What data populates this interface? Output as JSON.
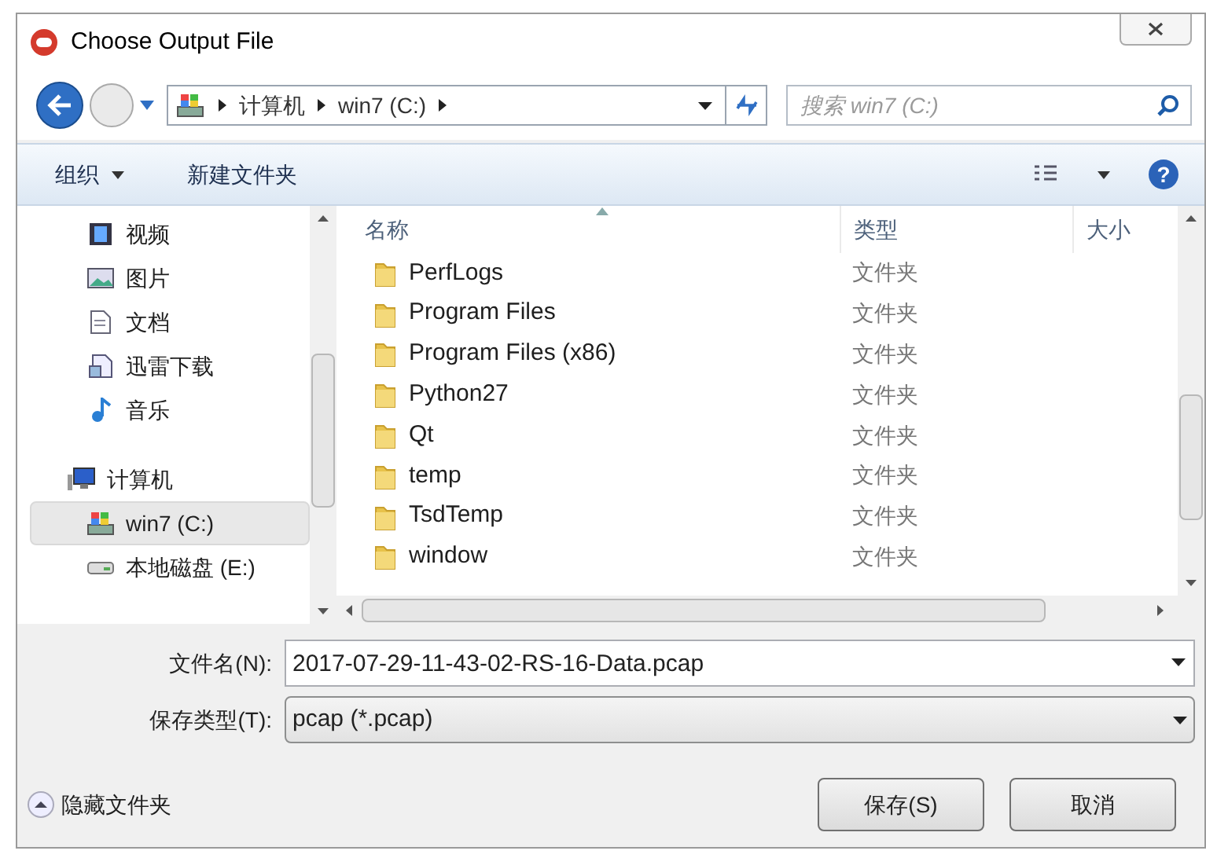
{
  "window": {
    "title": "Choose Output File"
  },
  "address": {
    "crumbs": [
      "计算机",
      "win7 (C:)"
    ]
  },
  "search": {
    "placeholder": "搜索 win7 (C:)"
  },
  "toolbar": {
    "organize": "组织",
    "new_folder": "新建文件夹",
    "help": "?"
  },
  "sidebar": {
    "items": [
      {
        "label": "视频",
        "kind": "video",
        "selected": false
      },
      {
        "label": "图片",
        "kind": "picture",
        "selected": false
      },
      {
        "label": "文档",
        "kind": "document",
        "selected": false
      },
      {
        "label": "迅雷下载",
        "kind": "download",
        "selected": false
      },
      {
        "label": "音乐",
        "kind": "music",
        "selected": false
      },
      {
        "label": "计算机",
        "kind": "computer",
        "selected": false,
        "children": [
          {
            "label": "win7 (C:)",
            "kind": "system-drive",
            "selected": true
          },
          {
            "label": "本地磁盘 (E:)",
            "kind": "drive",
            "selected": false
          }
        ]
      }
    ]
  },
  "table": {
    "columns": [
      "名称",
      "类型",
      "大小"
    ],
    "rows": [
      {
        "name": "PerfLogs",
        "type": "文件夹"
      },
      {
        "name": "Program Files",
        "type": "文件夹"
      },
      {
        "name": "Program Files (x86)",
        "type": "文件夹"
      },
      {
        "name": "Python27",
        "type": "文件夹"
      },
      {
        "name": "Qt",
        "type": "文件夹"
      },
      {
        "name": "temp",
        "type": "文件夹"
      },
      {
        "name": "TsdTemp",
        "type": "文件夹"
      },
      {
        "name": "window",
        "type": "文件夹"
      }
    ]
  },
  "form": {
    "file_name_label": "文件名(N):",
    "file_name": "2017-07-29-11-43-02-RS-16-Data.pcap",
    "type_label": "保存类型(T):",
    "type": "pcap (*.pcap)"
  },
  "hide_folders": "隐藏文件夹",
  "buttons": [
    "保存(S)",
    "取消"
  ]
}
